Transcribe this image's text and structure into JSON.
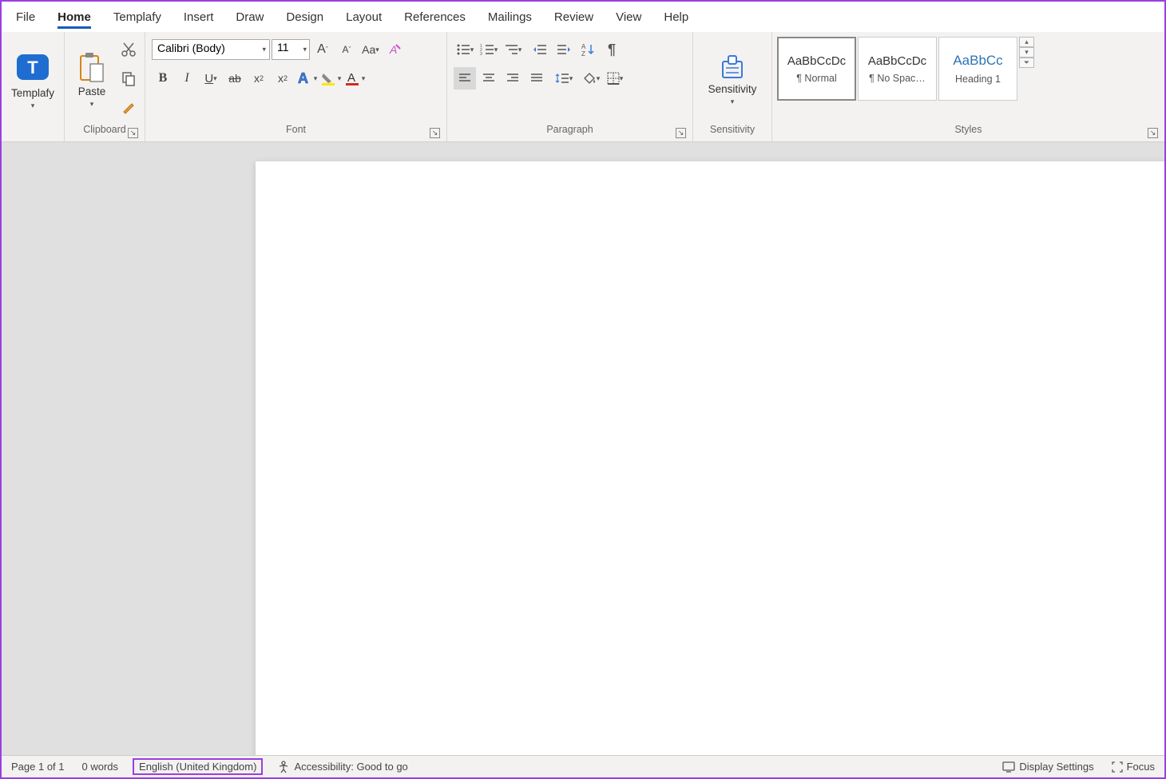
{
  "menu": {
    "tabs": [
      "File",
      "Home",
      "Templafy",
      "Insert",
      "Draw",
      "Design",
      "Layout",
      "References",
      "Mailings",
      "Review",
      "View",
      "Help"
    ],
    "active": "Home"
  },
  "groups": {
    "templafy": {
      "label": "Templafy"
    },
    "clipboard": {
      "label": "Clipboard",
      "paste": "Paste"
    },
    "font": {
      "label": "Font",
      "name": "Calibri (Body)",
      "size": "11"
    },
    "paragraph": {
      "label": "Paragraph"
    },
    "sensitivity": {
      "label": "Sensitivity",
      "btn": "Sensitivity"
    },
    "styles": {
      "label": "Styles",
      "preview": "AaBbCcDc",
      "previewHeading": "AaBbCc",
      "items": [
        "¶ Normal",
        "¶ No Spac…",
        "Heading 1"
      ]
    }
  },
  "status": {
    "page": "Page 1 of 1",
    "words": "0 words",
    "language": "English (United Kingdom)",
    "accessibility": "Accessibility: Good to go",
    "display": "Display Settings",
    "focus": "Focus"
  }
}
